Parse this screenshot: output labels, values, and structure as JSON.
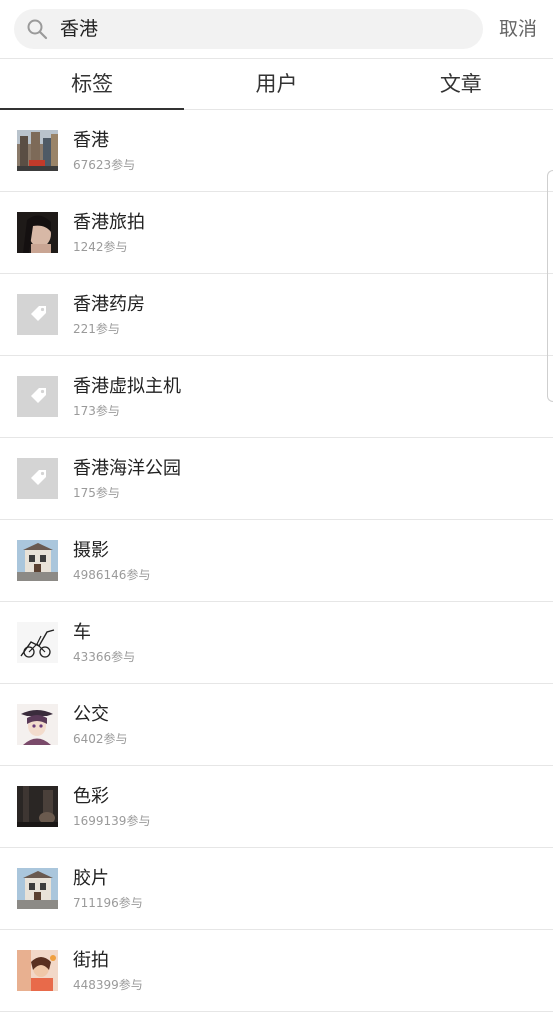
{
  "search": {
    "value": "香港",
    "cancel_label": "取消"
  },
  "tabs": [
    {
      "label": "标签",
      "active": true
    },
    {
      "label": "用户",
      "active": false
    },
    {
      "label": "文章",
      "active": false
    }
  ],
  "results": [
    {
      "title": "香港",
      "count": "67623参与",
      "thumb": "city-street-photo"
    },
    {
      "title": "香港旅拍",
      "count": "1242参与",
      "thumb": "portrait-photo"
    },
    {
      "title": "香港药房",
      "count": "221参与",
      "thumb": "tag-icon"
    },
    {
      "title": "香港虚拟主机",
      "count": "173参与",
      "thumb": "tag-icon"
    },
    {
      "title": "香港海洋公园",
      "count": "175参与",
      "thumb": "tag-icon"
    },
    {
      "title": "摄影",
      "count": "4986146参与",
      "thumb": "building-photo"
    },
    {
      "title": "车",
      "count": "43366参与",
      "thumb": "sketch-illustration"
    },
    {
      "title": "公交",
      "count": "6402参与",
      "thumb": "anime-illustration"
    },
    {
      "title": "色彩",
      "count": "1699139参与",
      "thumb": "dark-photo"
    },
    {
      "title": "胶片",
      "count": "711196参与",
      "thumb": "building-photo"
    },
    {
      "title": "街拍",
      "count": "448399参与",
      "thumb": "colorful-photo"
    }
  ]
}
